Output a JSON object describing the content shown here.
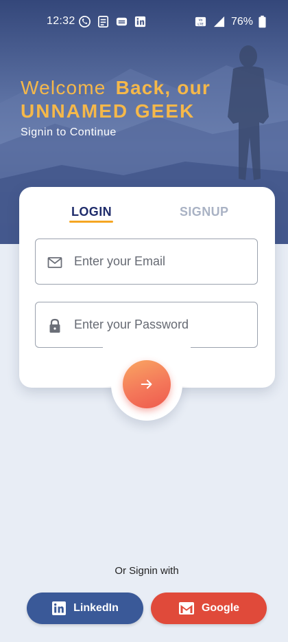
{
  "status_bar": {
    "time": "12:32",
    "battery": "76%",
    "left_icons": [
      "whatsapp-icon",
      "notes-icon",
      "message-icon",
      "linkedin-icon"
    ],
    "right_icons": [
      "volte-icon",
      "signal-icon",
      "battery-icon"
    ]
  },
  "hero": {
    "welcome_light": "Welcome",
    "welcome_bold": "Back, our",
    "name": "UNNAMED GEEK",
    "subtitle": "Signin to Continue"
  },
  "tabs": {
    "login": "LOGIN",
    "signup": "SIGNUP"
  },
  "form": {
    "email_placeholder": "Enter your Email",
    "password_placeholder": "Enter your Password"
  },
  "social": {
    "or_text": "Or Signin with",
    "linkedin_label": "LinkedIn",
    "google_label": "Google"
  },
  "colors": {
    "accent": "#f5b84a",
    "tab_active": "#1f2c6b",
    "tab_inactive": "#a9b2c4",
    "linkedin": "#3a5998",
    "google": "#e04a3a",
    "submit_start": "#f9a662",
    "submit_end": "#ee5a4d"
  }
}
